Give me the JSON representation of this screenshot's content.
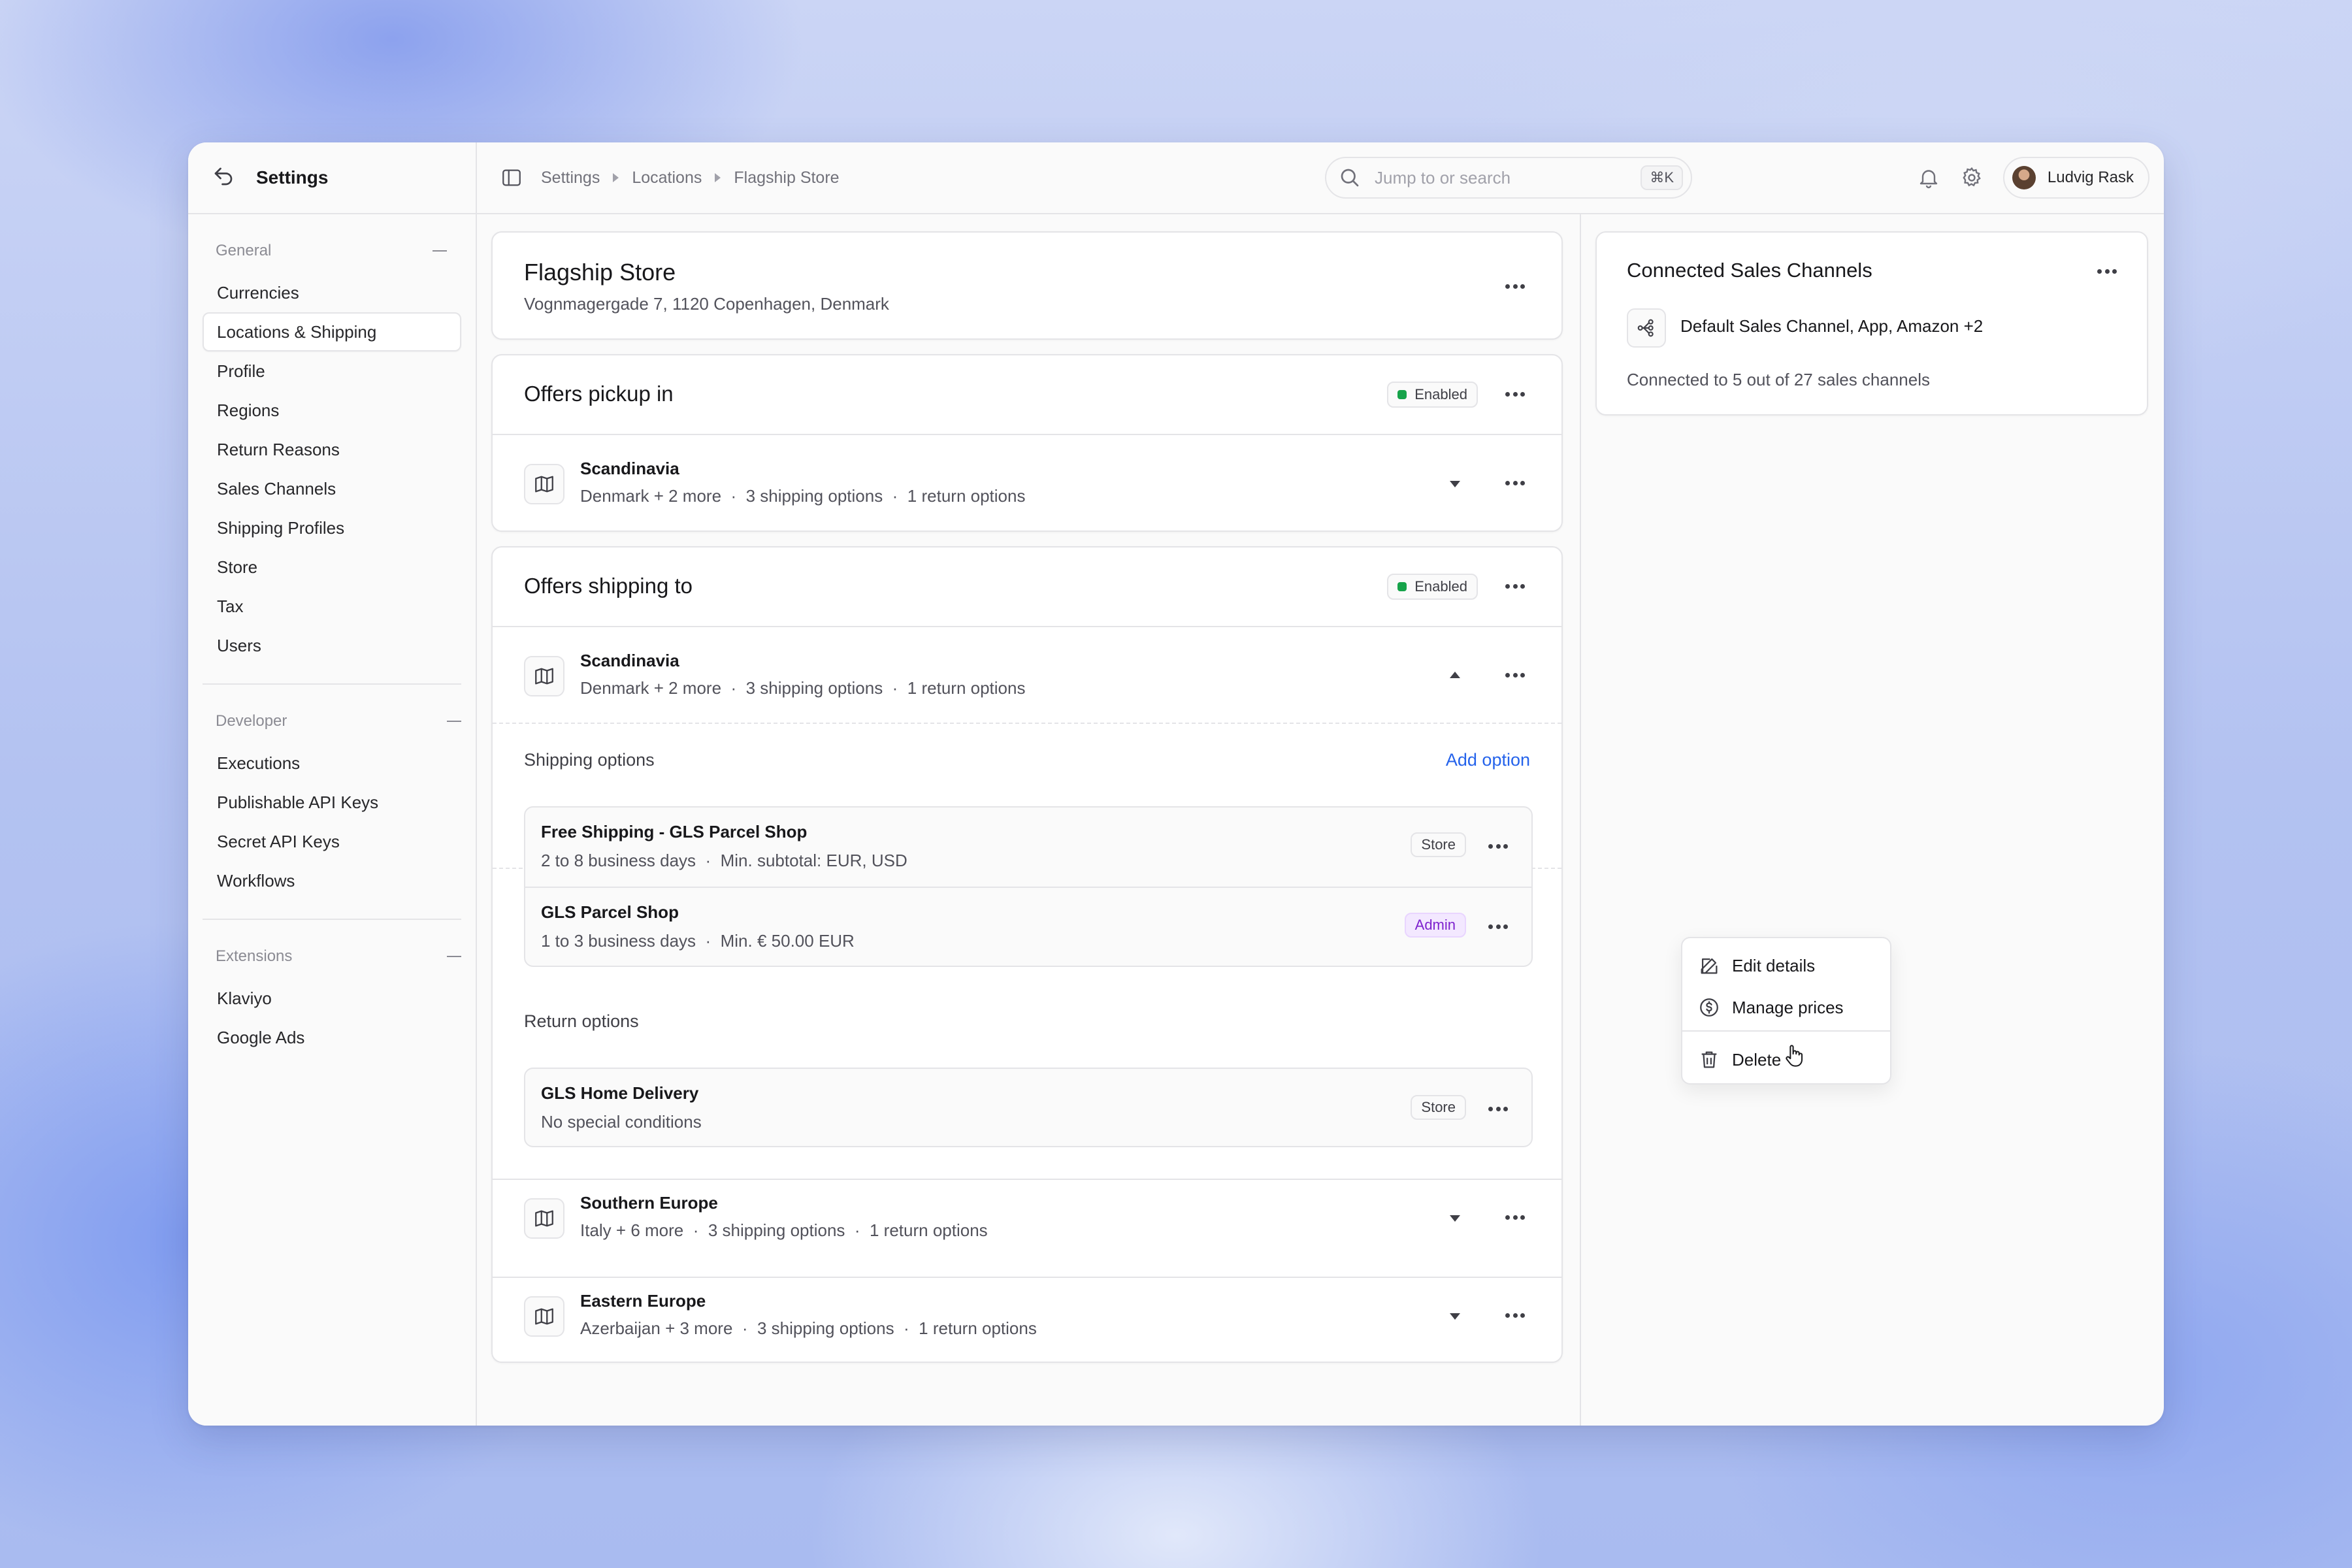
{
  "sidebar": {
    "title": "Settings",
    "sections": [
      {
        "title": "General",
        "items": [
          "Currencies",
          "Locations & Shipping",
          "Profile",
          "Regions",
          "Return Reasons",
          "Sales Channels",
          "Shipping Profiles",
          "Store",
          "Tax",
          "Users"
        ],
        "active": "Locations & Shipping"
      },
      {
        "title": "Developer",
        "items": [
          "Executions",
          "Publishable API Keys",
          "Secret API Keys",
          "Workflows"
        ]
      },
      {
        "title": "Extensions",
        "items": [
          "Klaviyo",
          "Google Ads"
        ]
      }
    ]
  },
  "topbar": {
    "breadcrumb": [
      "Settings",
      "Locations",
      "Flagship Store"
    ],
    "search_placeholder": "Jump to or search",
    "shortcut": "⌘K",
    "user_name": "Ludvig Rask"
  },
  "location": {
    "name": "Flagship Store",
    "address": "Vognmagergade 7, 1120 Copenhagen, Denmark"
  },
  "pickup": {
    "title": "Offers pickup in",
    "status": "Enabled",
    "zone": {
      "name": "Scandinavia",
      "countries": "Denmark + 2 more",
      "shipping": "3 shipping options",
      "returns": "1 return options"
    }
  },
  "shipping": {
    "title": "Offers shipping to",
    "status": "Enabled",
    "zone": {
      "name": "Scandinavia",
      "countries": "Denmark + 2 more",
      "shipping": "3 shipping options",
      "returns": "1 return options"
    },
    "shipping_options_label": "Shipping options",
    "add_option": "Add option",
    "options": [
      {
        "name": "Free Shipping - GLS Parcel Shop",
        "days": "2 to 8 business days",
        "rule": "Min. subtotal: EUR, USD",
        "badge": "Store"
      },
      {
        "name": "GLS Parcel Shop",
        "days": "1 to 3 business days",
        "rule": "Min. € 50.00 EUR",
        "badge": "Admin"
      }
    ],
    "return_options_label": "Return options",
    "returns": [
      {
        "name": "GLS Home Delivery",
        "rule": "No special conditions",
        "badge": "Store"
      }
    ],
    "other_zones": [
      {
        "name": "Southern Europe",
        "countries": "Italy + 6 more",
        "shipping": "3 shipping options",
        "returns": "1 return options"
      },
      {
        "name": "Eastern Europe",
        "countries": "Azerbaijan + 3 more",
        "shipping": "3 shipping options",
        "returns": "1 return options"
      }
    ]
  },
  "context_menu": {
    "items": [
      "Edit details",
      "Manage prices",
      "Delete"
    ]
  },
  "sales_channels": {
    "title": "Connected Sales Channels",
    "channels": "Default Sales Channel, App, Amazon +2",
    "summary": "Connected to 5 out of 27 sales channels"
  },
  "separator": "·",
  "colors": {
    "accent": "#2563eb",
    "enabled": "#16a34a",
    "admin": "#7e22ce"
  }
}
